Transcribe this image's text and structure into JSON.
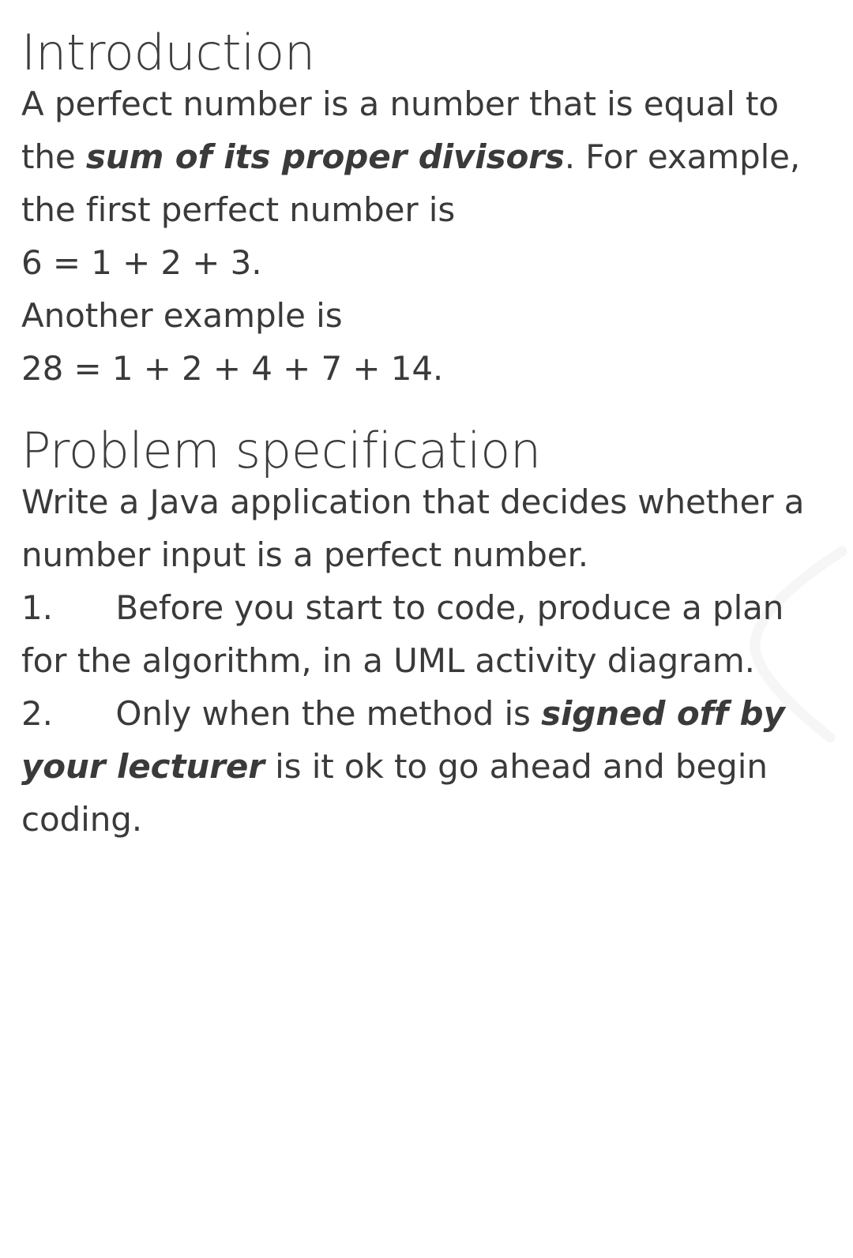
{
  "document": {
    "background_color": "#ffffff",
    "text_color": "#3a3a3a",
    "watermark_color": "#f7f7f7"
  },
  "sections": [
    {
      "heading": "Introduction",
      "paragraphs": [
        {
          "before": "A perfect number is a number that is equal to the ",
          "emphasis": "sum of its proper divisors",
          "after": ". For example, the first perfect number is"
        },
        {
          "text": "6 = 1 + 2 + 3."
        },
        {
          "text": "Another example is"
        },
        {
          "text": "28 = 1 + 2 + 4 + 7 + 14."
        }
      ]
    },
    {
      "heading": "Problem specification",
      "paragraphs": [
        {
          "text": "Write a Java application that decides whether a number input is a perfect number."
        }
      ],
      "list": [
        {
          "marker": "1.",
          "indent": "      ",
          "before": "Before you start to code, produce a plan for the algorithm, in a UML activity diagram.",
          "emphasis": "",
          "after": ""
        },
        {
          "marker": "2.",
          "indent": "      ",
          "before": "Only when the method is ",
          "emphasis": "signed off by your lecturer",
          "after": " is it ok to go ahead and begin coding."
        }
      ]
    }
  ]
}
